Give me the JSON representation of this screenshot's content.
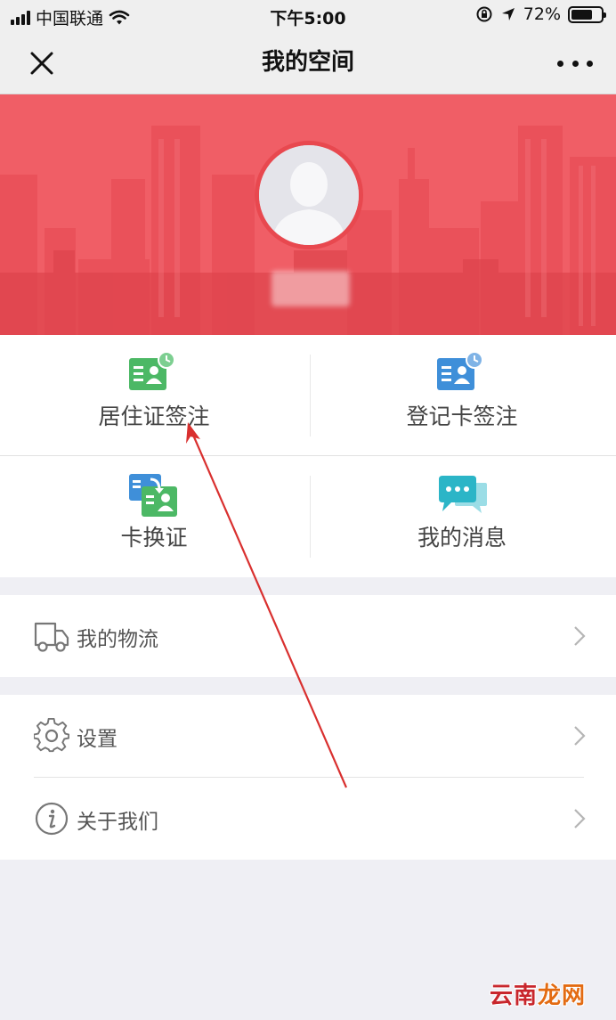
{
  "status_bar": {
    "carrier": "中国联通",
    "time": "下午5:00",
    "battery": "72%",
    "battery_level": 0.72
  },
  "nav": {
    "title": "我的空间",
    "close_icon": "close-icon",
    "more_icon": "more-dots-icon"
  },
  "profile": {
    "avatar_icon": "default-avatar-icon",
    "username_hidden": true
  },
  "grid": {
    "items": [
      {
        "label": "居住证签注",
        "icon": "residence-permit-icon",
        "color": "#4cb865"
      },
      {
        "label": "登记卡签注",
        "icon": "registration-card-icon",
        "color": "#3f8fd9"
      },
      {
        "label": "卡换证",
        "icon": "card-exchange-icon",
        "color": "#3f8fd9"
      },
      {
        "label": "我的消息",
        "icon": "chat-bubble-icon",
        "color": "#2bb5c7"
      }
    ]
  },
  "menu": {
    "logistics": {
      "label": "我的物流",
      "icon": "truck-icon"
    },
    "settings": {
      "label": "设置",
      "icon": "gear-icon"
    },
    "about": {
      "label": "关于我们",
      "icon": "info-icon"
    }
  },
  "colors": {
    "banner": "#f05e66",
    "annotation_arrow": "#d9302f",
    "background": "#efeff4"
  },
  "watermark": {
    "part1": "云南",
    "part2": "龙网"
  }
}
